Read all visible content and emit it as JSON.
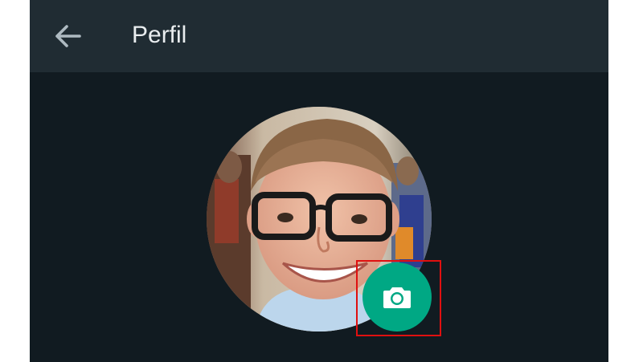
{
  "header": {
    "title": "Perfil",
    "back_icon": "arrow-left-icon"
  },
  "profile": {
    "photo": "profile-photo",
    "change_photo_icon": "camera-icon"
  },
  "colors": {
    "header_bg": "#202c33",
    "body_bg": "#111b21",
    "accent": "#00a884",
    "highlight": "#e01010"
  }
}
